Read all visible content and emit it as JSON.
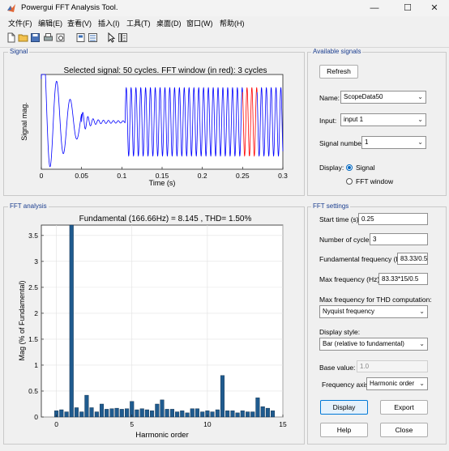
{
  "window": {
    "title": "Powergui FFT Analysis Tool."
  },
  "menu": [
    "文件(F)",
    "编辑(E)",
    "查看(V)",
    "插入(I)",
    "工具(T)",
    "桌面(D)",
    "窗口(W)",
    "帮助(H)"
  ],
  "panels": {
    "signal": "Signal",
    "fft": "FFT analysis",
    "available": "Available signals",
    "settings": "FFT settings"
  },
  "available": {
    "refresh": "Refresh",
    "name_label": "Name:",
    "name_value": "ScopeData50",
    "input_label": "Input:",
    "input_value": "input 1",
    "signal_number_label": "Signal number:",
    "signal_number_value": "1",
    "display_label": "Display:",
    "display_signal": "Signal",
    "display_fft": "FFT window"
  },
  "settings": {
    "start_time_label": "Start time (s):",
    "start_time_value": "0.25",
    "cycles_label": "Number of cycles:",
    "cycles_value": "3",
    "fund_label": "Fundamental frequency (Hz):",
    "fund_value": "83.33/0.5",
    "max_label": "Max frequency (Hz):",
    "max_value": "83.33*15/0.5",
    "thd_label": "Max frequency for THD computation:",
    "thd_value": "Nyquist frequency",
    "style_label": "Display style:",
    "style_value": "Bar (relative to fundamental)",
    "base_label": "Base value:",
    "base_value": "1.0",
    "axis_label": "Frequency axis:",
    "axis_value": "Harmonic order",
    "display": "Display",
    "export": "Export",
    "help": "Help",
    "close": "Close"
  },
  "chart_data": [
    {
      "type": "line",
      "title": "Selected signal: 50 cycles. FFT window (in red): 3 cycles",
      "xlabel": "Time (s)",
      "ylabel": "Signal mag.",
      "xlim": [
        0,
        0.3
      ],
      "ylim": [
        -1,
        1
      ],
      "xticks": [
        "0",
        "0.05",
        "0.1",
        "0.15",
        "0.2",
        "0.25",
        "0.3"
      ],
      "series": [
        {
          "color": "#0000ff"
        },
        {
          "color": "#ff0000"
        }
      ],
      "fft_window": [
        0.25,
        0.268
      ]
    },
    {
      "type": "bar",
      "title": "Fundamental (166.66Hz) = 8.145 , THD= 1.50%",
      "xlabel": "Harmonic order",
      "ylabel": "Mag (% of Fundamental)",
      "xlim": [
        -1,
        15
      ],
      "ylim": [
        0,
        3.7
      ],
      "xticks": [
        "0",
        "5",
        "10",
        "15"
      ],
      "yticks": [
        "0",
        "0.5",
        "1",
        "1.5",
        "2",
        "2.5",
        "3",
        "3.5"
      ],
      "x": [
        0,
        0.33,
        0.67,
        1,
        1.33,
        1.67,
        2,
        2.33,
        2.67,
        3,
        3.33,
        3.67,
        4,
        4.33,
        4.67,
        5,
        5.33,
        5.67,
        6,
        6.33,
        6.67,
        7,
        7.33,
        7.67,
        8,
        8.33,
        8.67,
        9,
        9.33,
        9.67,
        10,
        10.33,
        10.67,
        11,
        11.33,
        11.67,
        12,
        12.33,
        12.67,
        13,
        13.33,
        13.67,
        14,
        14.33
      ],
      "values": [
        0.12,
        0.14,
        0.1,
        3.9,
        0.18,
        0.1,
        0.42,
        0.18,
        0.1,
        0.25,
        0.15,
        0.16,
        0.17,
        0.15,
        0.16,
        0.3,
        0.14,
        0.16,
        0.14,
        0.12,
        0.25,
        0.33,
        0.15,
        0.15,
        0.1,
        0.12,
        0.08,
        0.16,
        0.16,
        0.1,
        0.12,
        0.1,
        0.14,
        0.8,
        0.12,
        0.12,
        0.08,
        0.12,
        0.1,
        0.1,
        0.37,
        0.2,
        0.17,
        0.12
      ],
      "color": "#1f5b8f"
    }
  ]
}
